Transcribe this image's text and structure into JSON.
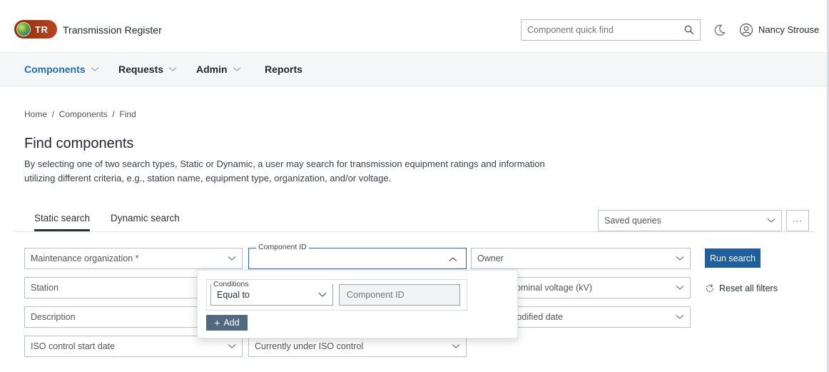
{
  "app": {
    "logo_text": "TR",
    "title": "Transmission Register"
  },
  "header": {
    "quick_find_placeholder": "Component quick find",
    "user_name": "Nancy Strouse"
  },
  "nav": {
    "items": [
      {
        "label": "Components",
        "active": true,
        "has_dropdown": true
      },
      {
        "label": "Requests",
        "active": false,
        "has_dropdown": true
      },
      {
        "label": "Admin",
        "active": false,
        "has_dropdown": true
      },
      {
        "label": "Reports",
        "active": false,
        "has_dropdown": false
      }
    ]
  },
  "breadcrumb": "Home  /  Components  /  Find",
  "page": {
    "title": "Find components",
    "description": "By selecting one of two search types, Static or Dynamic, a user may search for transmission equipment ratings and information utilizing different criteria, e.g., station name, equipment type, organization, and/or voltage."
  },
  "tabs": [
    {
      "label": "Static search",
      "active": true
    },
    {
      "label": "Dynamic search",
      "active": false
    }
  ],
  "saved_queries": {
    "label": "Saved queries",
    "more_label": "···"
  },
  "filters": {
    "maintenance_org": "Maintenance organization *",
    "component_id_label": "Component ID",
    "owner": "Owner",
    "station": "Station",
    "nominal_voltage": "Nominal voltage (kV)",
    "description": "Description",
    "modified_date": "Modified date",
    "iso_start": "ISO control start date",
    "iso_current": "Currently under ISO control"
  },
  "actions": {
    "run_search": "Run search",
    "reset_filters": "Reset all filters"
  },
  "popover": {
    "conditions_legend": "Conditions",
    "condition_value": "Equal to",
    "input_placeholder": "Component ID",
    "add_label": "Add"
  },
  "colors": {
    "primary": "#1f5f9e",
    "active_nav": "#1f6fae",
    "add_button": "#4f6a80",
    "logo": "#a53c1a"
  }
}
